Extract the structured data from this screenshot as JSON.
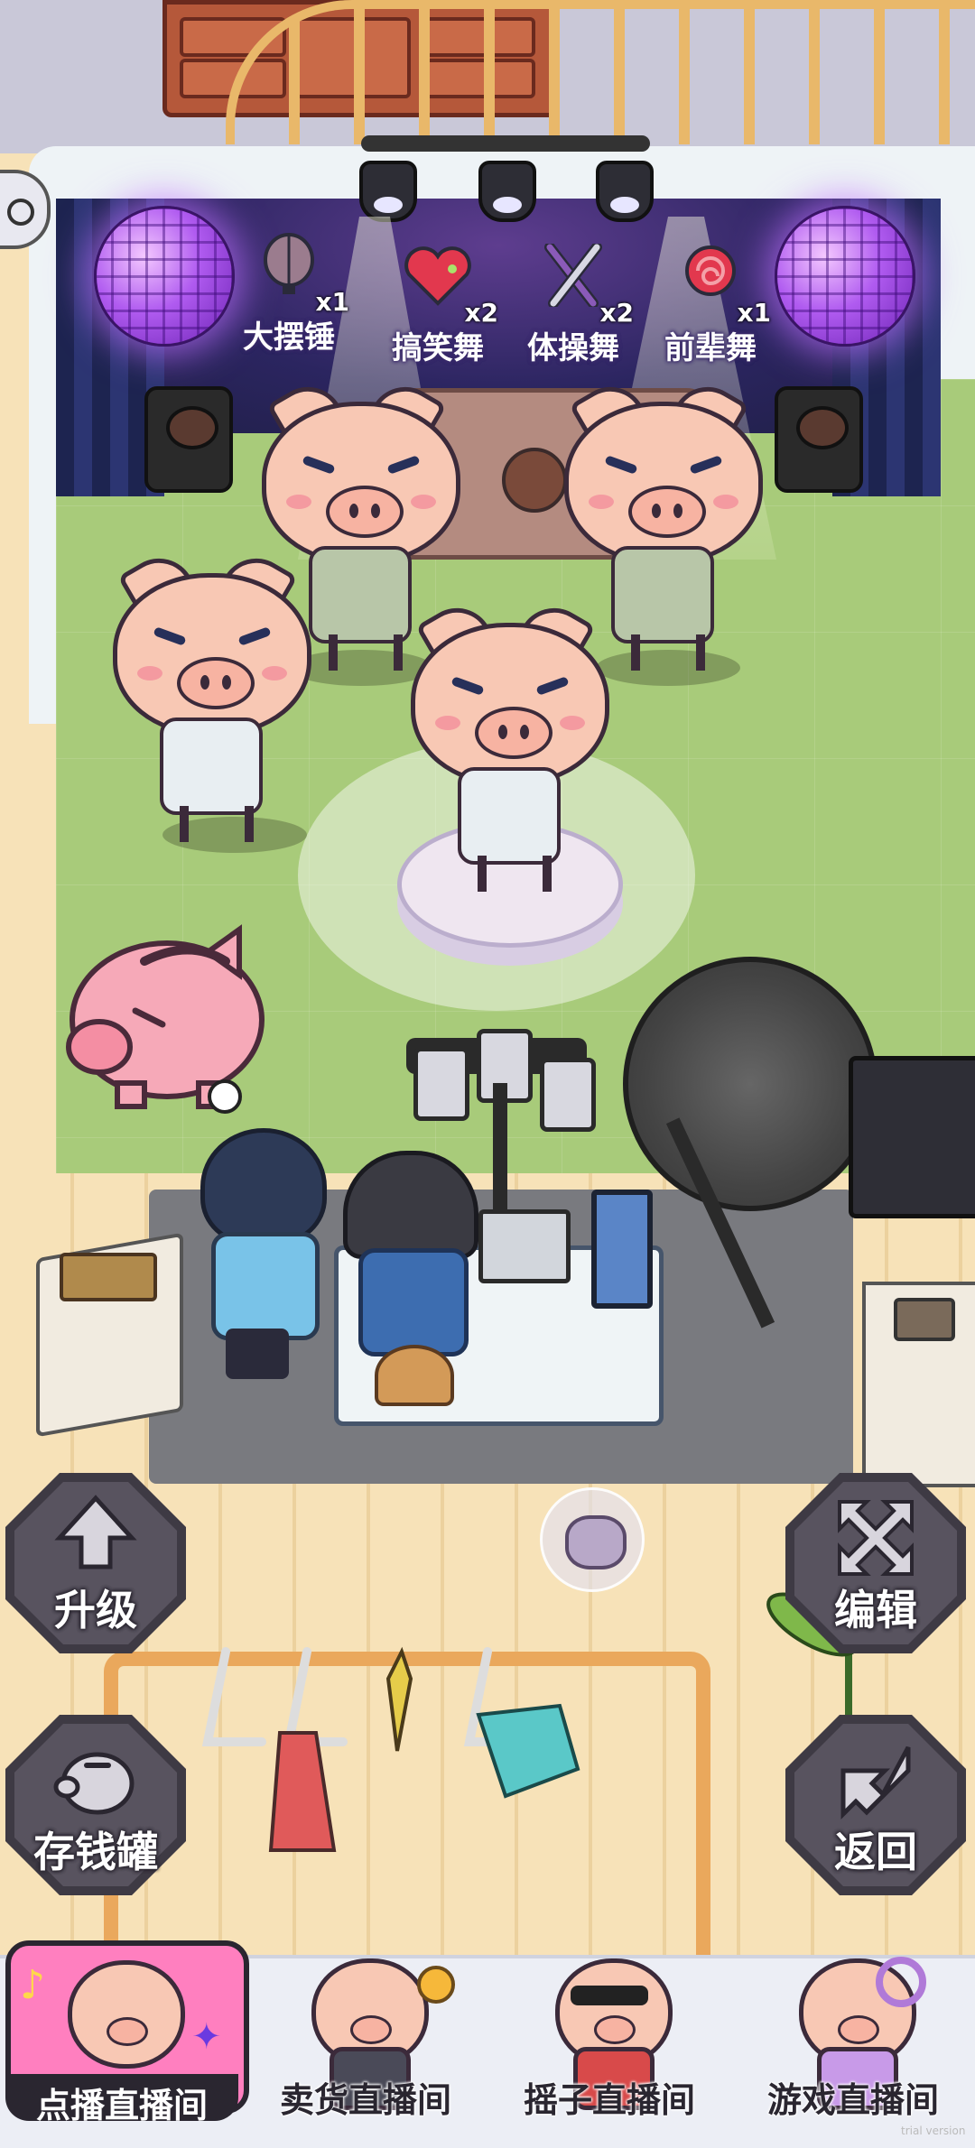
{
  "stage_items": [
    {
      "label": "大摆锤",
      "count": "x1",
      "icon": "balloon-icon",
      "color": "#9b7c8e"
    },
    {
      "label": "搞笑舞",
      "count": "x2",
      "icon": "heart-icon",
      "color": "#e2384e"
    },
    {
      "label": "体操舞",
      "count": "x2",
      "icon": "crossed-sticks-icon",
      "color": "#8a5ab8"
    },
    {
      "label": "前辈舞",
      "count": "x1",
      "icon": "lollipop-icon",
      "color": "#e2384e"
    }
  ],
  "hud_buttons": {
    "upgrade": {
      "label": "升级",
      "icon": "arrow-up-icon"
    },
    "edit": {
      "label": "编辑",
      "icon": "move-arrows-icon"
    },
    "piggybank": {
      "label": "存钱罐",
      "icon": "piggy-bank-icon"
    },
    "back": {
      "label": "返回",
      "icon": "return-arrow-icon"
    }
  },
  "tabs": [
    {
      "label": "点播直播间",
      "active": true,
      "accent": "#ff7fbf"
    },
    {
      "label": "卖货直播间",
      "active": false
    },
    {
      "label": "摇子直播间",
      "active": false
    },
    {
      "label": "游戏直播间",
      "active": false
    }
  ],
  "footer": {
    "version_text": "trial version"
  },
  "colors": {
    "stage_floor": "#a8cb7a",
    "disco": "#b05bf0",
    "hud": "#58535f",
    "tab_active": "#ff7fbf"
  }
}
